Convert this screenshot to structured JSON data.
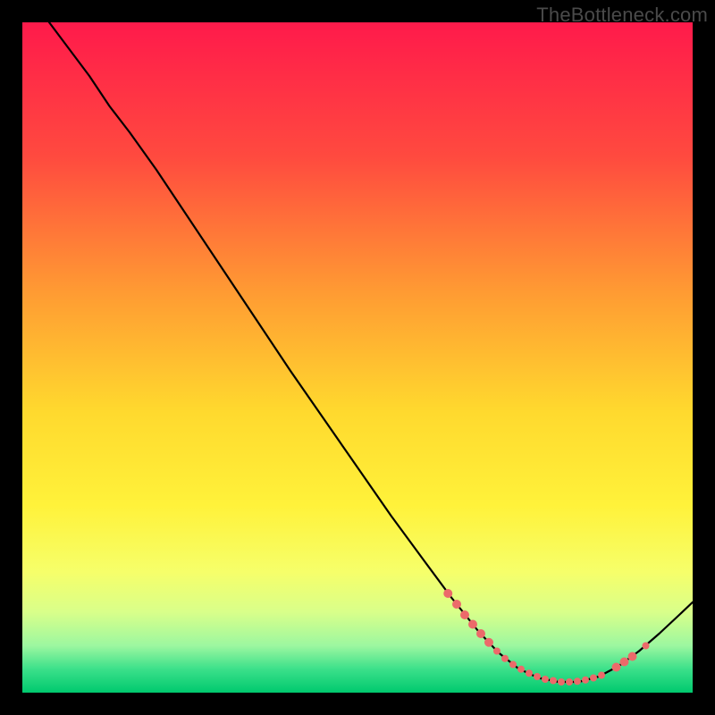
{
  "watermark": "TheBottleneck.com",
  "chart_data": {
    "type": "line",
    "title": "",
    "xlabel": "",
    "ylabel": "",
    "xlim": [
      0,
      100
    ],
    "ylim": [
      0,
      100
    ],
    "gradient_stops": [
      {
        "offset": 0.0,
        "color": "#ff1a4b"
      },
      {
        "offset": 0.2,
        "color": "#ff4a3f"
      },
      {
        "offset": 0.4,
        "color": "#ff9a33"
      },
      {
        "offset": 0.58,
        "color": "#ffd92e"
      },
      {
        "offset": 0.72,
        "color": "#fff23a"
      },
      {
        "offset": 0.82,
        "color": "#f6ff6a"
      },
      {
        "offset": 0.88,
        "color": "#d9ff8a"
      },
      {
        "offset": 0.93,
        "color": "#9cf7a0"
      },
      {
        "offset": 0.965,
        "color": "#3be08a"
      },
      {
        "offset": 1.0,
        "color": "#00c96e"
      }
    ],
    "curve": [
      {
        "x": 4.0,
        "y": 100.0
      },
      {
        "x": 7.0,
        "y": 96.0
      },
      {
        "x": 10.0,
        "y": 92.0
      },
      {
        "x": 13.0,
        "y": 87.5
      },
      {
        "x": 16.0,
        "y": 83.6
      },
      {
        "x": 20.0,
        "y": 78.0
      },
      {
        "x": 25.0,
        "y": 70.5
      },
      {
        "x": 30.0,
        "y": 63.0
      },
      {
        "x": 35.0,
        "y": 55.5
      },
      {
        "x": 40.0,
        "y": 48.0
      },
      {
        "x": 45.0,
        "y": 40.8
      },
      {
        "x": 50.0,
        "y": 33.6
      },
      {
        "x": 55.0,
        "y": 26.4
      },
      {
        "x": 60.0,
        "y": 19.6
      },
      {
        "x": 64.0,
        "y": 14.2
      },
      {
        "x": 68.0,
        "y": 9.2
      },
      {
        "x": 71.0,
        "y": 6.0
      },
      {
        "x": 74.0,
        "y": 3.6
      },
      {
        "x": 77.0,
        "y": 2.2
      },
      {
        "x": 80.0,
        "y": 1.6
      },
      {
        "x": 83.0,
        "y": 1.6
      },
      {
        "x": 86.0,
        "y": 2.4
      },
      {
        "x": 89.0,
        "y": 4.0
      },
      {
        "x": 92.0,
        "y": 6.2
      },
      {
        "x": 95.0,
        "y": 8.8
      },
      {
        "x": 98.0,
        "y": 11.6
      },
      {
        "x": 100.0,
        "y": 13.5
      }
    ],
    "markers": [
      {
        "x": 63.5,
        "y": 14.8,
        "r": 5
      },
      {
        "x": 64.8,
        "y": 13.2,
        "r": 5
      },
      {
        "x": 66.0,
        "y": 11.6,
        "r": 5
      },
      {
        "x": 67.2,
        "y": 10.2,
        "r": 5
      },
      {
        "x": 68.4,
        "y": 8.8,
        "r": 5
      },
      {
        "x": 69.6,
        "y": 7.5,
        "r": 5
      },
      {
        "x": 70.8,
        "y": 6.2,
        "r": 4
      },
      {
        "x": 72.0,
        "y": 5.1,
        "r": 4
      },
      {
        "x": 73.2,
        "y": 4.2,
        "r": 4
      },
      {
        "x": 74.4,
        "y": 3.5,
        "r": 4
      },
      {
        "x": 75.6,
        "y": 2.9,
        "r": 4
      },
      {
        "x": 76.8,
        "y": 2.4,
        "r": 4
      },
      {
        "x": 78.0,
        "y": 2.0,
        "r": 4
      },
      {
        "x": 79.2,
        "y": 1.8,
        "r": 4
      },
      {
        "x": 80.4,
        "y": 1.6,
        "r": 4
      },
      {
        "x": 81.6,
        "y": 1.6,
        "r": 4
      },
      {
        "x": 82.8,
        "y": 1.7,
        "r": 4
      },
      {
        "x": 84.0,
        "y": 1.9,
        "r": 4
      },
      {
        "x": 85.2,
        "y": 2.2,
        "r": 4
      },
      {
        "x": 86.4,
        "y": 2.6,
        "r": 4
      },
      {
        "x": 88.6,
        "y": 3.8,
        "r": 5
      },
      {
        "x": 89.8,
        "y": 4.6,
        "r": 5
      },
      {
        "x": 91.0,
        "y": 5.4,
        "r": 5
      },
      {
        "x": 93.0,
        "y": 7.0,
        "r": 4
      }
    ],
    "marker_color": "#ec6a6a",
    "line_color": "#000000"
  }
}
